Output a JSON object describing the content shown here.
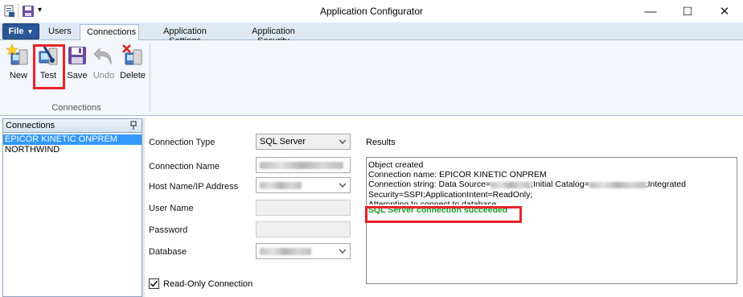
{
  "window": {
    "title": "Application Configurator",
    "minimize_glyph": "—",
    "maximize_glyph": "☐",
    "close_glyph": "✕"
  },
  "tabs": {
    "file_label": "File",
    "items": [
      {
        "label": "Users"
      },
      {
        "label": "Connections"
      },
      {
        "label": "Application Settings"
      },
      {
        "label": "Application Security"
      }
    ],
    "active": "Connections"
  },
  "ribbon": {
    "buttons": [
      {
        "label": "New",
        "icon": "new-connection-icon",
        "enabled": true
      },
      {
        "label": "Test",
        "icon": "test-connection-icon",
        "enabled": true
      },
      {
        "label": "Save",
        "icon": "save-icon",
        "enabled": true
      },
      {
        "label": "Undo",
        "icon": "undo-icon",
        "enabled": false
      },
      {
        "label": "Delete",
        "icon": "delete-connection-icon",
        "enabled": true
      }
    ],
    "group_label": "Connections"
  },
  "connections_panel": {
    "header": "Connections",
    "items": [
      "EPICOR KINETIC ONPREM",
      "NORTHWIND"
    ],
    "selected": "EPICOR KINETIC ONPREM"
  },
  "form": {
    "connection_type": {
      "label": "Connection Type",
      "value": "SQL Server"
    },
    "connection_name": {
      "label": "Connection Name"
    },
    "host_name": {
      "label": "Host Name/IP Address"
    },
    "user_name": {
      "label": "User Name"
    },
    "password": {
      "label": "Password"
    },
    "database": {
      "label": "Database"
    },
    "read_only": {
      "label": "Read-Only Connection",
      "checked": true
    }
  },
  "results": {
    "label": "Results",
    "lines": [
      "Object created",
      "Connection name: EPICOR KINETIC ONPREM",
      "Connection string: Data Source=",
      "Security=SSPI;ApplicationIntent=ReadOnly;",
      "Attempting to connect to database",
      "SQL Server connection succeeded"
    ],
    "line3_mid": ";Initial Catalog=",
    "line3_end": ";Integrated"
  },
  "colors": {
    "highlight": "#e8242b",
    "success_text": "#1a9a2c",
    "selection": "#3399ff",
    "file_button": "#2b5797"
  }
}
